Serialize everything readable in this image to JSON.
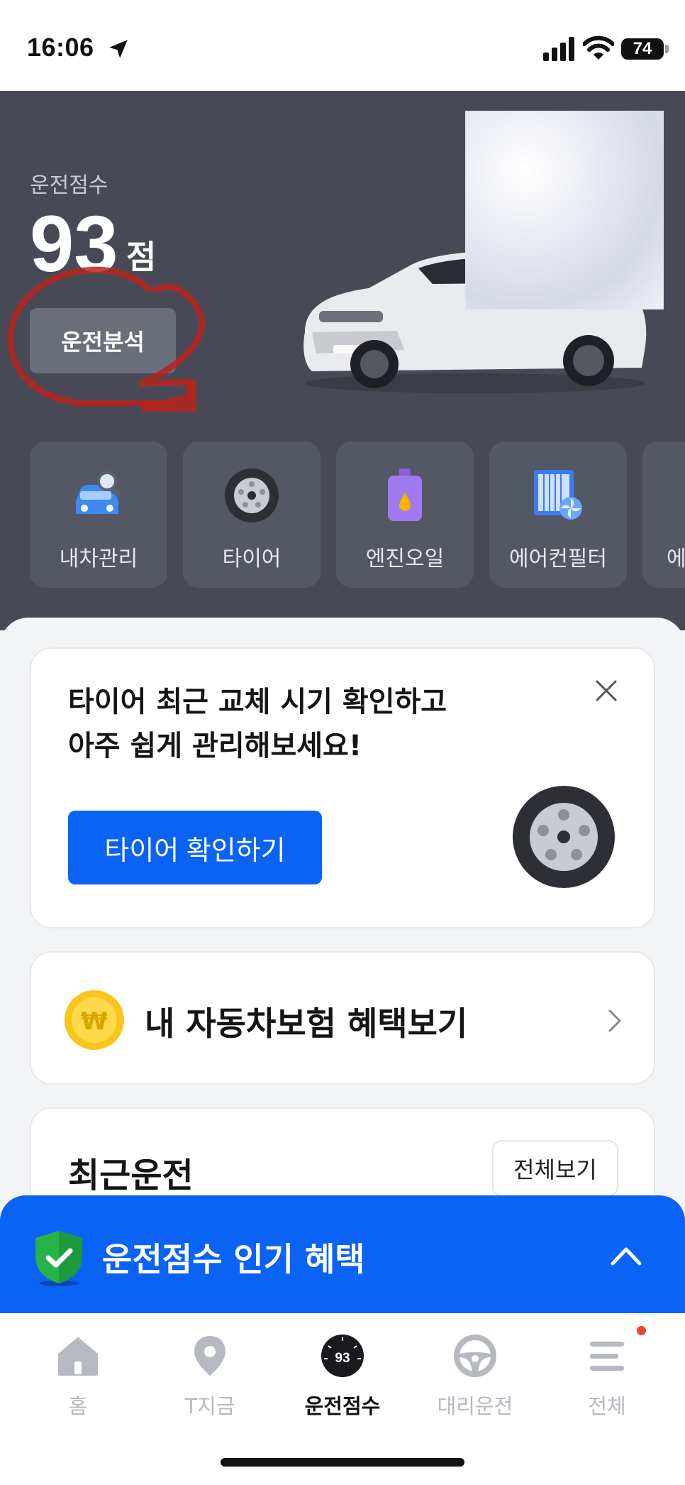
{
  "status_bar": {
    "time": "16:06",
    "battery": "74"
  },
  "hero": {
    "score_label": "운전점수",
    "score": "93",
    "score_unit": "점",
    "analysis_button": "운전분석"
  },
  "quick_menu": [
    {
      "label": "내차관리",
      "icon": "car-search-icon"
    },
    {
      "label": "타이어",
      "icon": "tire-icon"
    },
    {
      "label": "엔진오일",
      "icon": "engine-oil-icon"
    },
    {
      "label": "에어컨필터",
      "icon": "aircon-filter-icon"
    },
    {
      "label": "에",
      "icon": "partial-item"
    }
  ],
  "tire_card": {
    "title": "타이어 최근 교체 시기 확인하고\n아주 쉽게 관리해보세요!",
    "button": "타이어 확인하기"
  },
  "insurance_card": {
    "text": "내 자동차보험 혜택보기",
    "coin_symbol": "₩"
  },
  "recent_card": {
    "title": "최근운전",
    "view_all": "전체보기"
  },
  "benefit_bar": {
    "text": "운전점수 인기 혜택"
  },
  "tabs": [
    {
      "label": "홈",
      "icon": "home-icon"
    },
    {
      "label": "T지금",
      "icon": "location-pin-icon"
    },
    {
      "label": "운전점수",
      "icon": "driving-score-icon",
      "badge": "93",
      "active": true
    },
    {
      "label": "대리운전",
      "icon": "steering-wheel-icon"
    },
    {
      "label": "전체",
      "icon": "menu-icon"
    }
  ],
  "colors": {
    "primary": "#0a63f5",
    "hero_bg": "#474a56",
    "annotation": "#b8231c"
  }
}
